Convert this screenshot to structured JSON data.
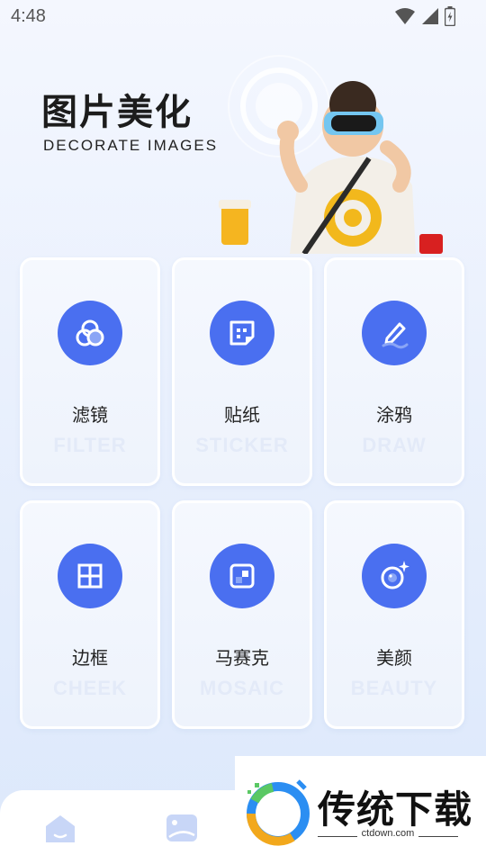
{
  "status_bar": {
    "time": "4:48"
  },
  "hero": {
    "title": "图片美化",
    "subtitle": "DECORATE IMAGES"
  },
  "features": [
    {
      "label": "滤镜",
      "sublabel": "FILTER",
      "icon": "filter-circles-icon"
    },
    {
      "label": "贴纸",
      "sublabel": "STICKER",
      "icon": "sticker-icon"
    },
    {
      "label": "涂鸦",
      "sublabel": "DRAW",
      "icon": "pen-draw-icon"
    },
    {
      "label": "边框",
      "sublabel": "CHEEK",
      "icon": "frame-grid-icon"
    },
    {
      "label": "马赛克",
      "sublabel": "MOSAIC",
      "icon": "mosaic-icon"
    },
    {
      "label": "美颜",
      "sublabel": "BEAUTY",
      "icon": "camera-sparkle-icon"
    }
  ],
  "bottom_nav": {
    "items": [
      {
        "icon": "home-icon"
      },
      {
        "icon": "gallery-icon"
      }
    ]
  },
  "watermark": {
    "brand": "传统下载",
    "url": "ctdown.com"
  },
  "colors": {
    "accent": "#4a6ff0",
    "background": "#e9f0fd",
    "card": "#f5f8fe",
    "nav_icon": "#c8d6f7"
  }
}
